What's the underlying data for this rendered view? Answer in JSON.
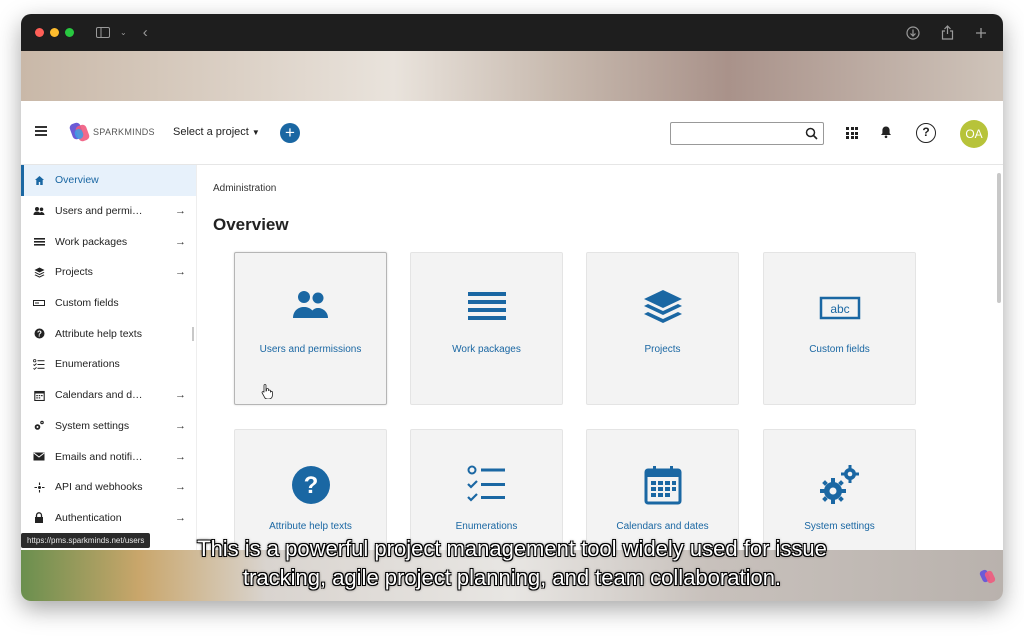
{
  "header": {
    "logo_text": "SPARKMINDS",
    "project_select": "Select a project",
    "avatar_initials": "OA",
    "search_placeholder": "",
    "help_symbol": "?"
  },
  "sidebar": {
    "items": [
      {
        "label": "Overview",
        "icon": "home-icon",
        "active": true,
        "arrow": false
      },
      {
        "label": "Users and permi…",
        "icon": "users-icon",
        "active": false,
        "arrow": true
      },
      {
        "label": "Work packages",
        "icon": "list-icon",
        "active": false,
        "arrow": true
      },
      {
        "label": "Projects",
        "icon": "layers-icon",
        "active": false,
        "arrow": true
      },
      {
        "label": "Custom fields",
        "icon": "custom-field-icon",
        "active": false,
        "arrow": false
      },
      {
        "label": "Attribute help texts",
        "icon": "help-circle-icon",
        "active": false,
        "arrow": false
      },
      {
        "label": "Enumerations",
        "icon": "enumeration-icon",
        "active": false,
        "arrow": false
      },
      {
        "label": "Calendars and d…",
        "icon": "calendar-icon",
        "active": false,
        "arrow": true
      },
      {
        "label": "System settings",
        "icon": "settings-gears-icon",
        "active": false,
        "arrow": true
      },
      {
        "label": "Emails and notifi…",
        "icon": "mail-icon",
        "active": false,
        "arrow": true
      },
      {
        "label": "API and webhooks",
        "icon": "api-icon",
        "active": false,
        "arrow": true
      },
      {
        "label": "Authentication",
        "icon": "lock-icon",
        "active": false,
        "arrow": true
      }
    ],
    "arrow_symbol": "→"
  },
  "main": {
    "breadcrumb": "Administration",
    "title": "Overview",
    "tiles": [
      {
        "label": "Users and permissions",
        "icon": "users-icon"
      },
      {
        "label": "Work packages",
        "icon": "list-icon"
      },
      {
        "label": "Projects",
        "icon": "layers-icon"
      },
      {
        "label": "Custom fields",
        "icon": "abc-field-icon",
        "icon_text": "abc"
      },
      {
        "label": "Attribute help texts",
        "icon": "help-circle-icon"
      },
      {
        "label": "Enumerations",
        "icon": "enumeration-icon"
      },
      {
        "label": "Calendars and dates",
        "icon": "calendar-icon"
      },
      {
        "label": "System settings",
        "icon": "settings-gears-icon"
      }
    ]
  },
  "status_bar": {
    "url": "https://pms.sparkminds.net/users"
  },
  "subtitle": {
    "line1": "This is a powerful project management tool widely used for issue",
    "line2": "tracking, agile project planning, and team collaboration."
  },
  "colors": {
    "accent": "#1a67a3",
    "avatar_bg": "#b7c33a",
    "active_bg": "#e7f1fb",
    "tile_bg": "#f3f3f3"
  }
}
